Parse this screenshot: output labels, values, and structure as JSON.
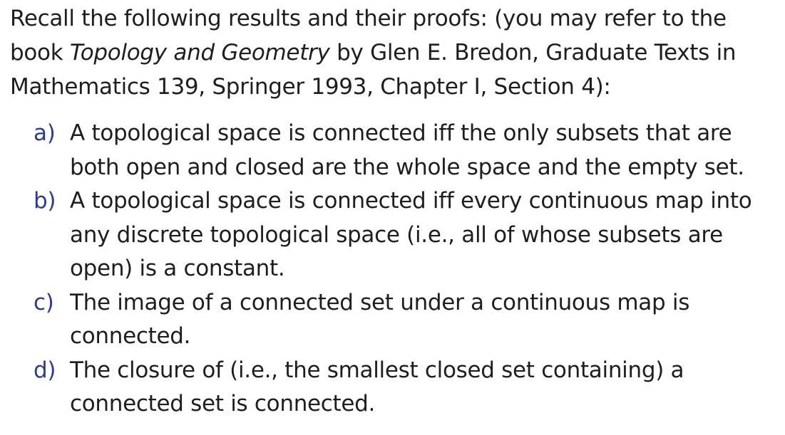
{
  "intro": {
    "before_book": "Recall the following results and their proofs: (you may refer to the book ",
    "book_title": "Topology and Geometry",
    "after_book": " by Glen E. Bredon, Graduate Texts in Mathematics 139, Springer 1993, Chapter I, Section 4):"
  },
  "items": [
    {
      "marker": "a)",
      "text": "A topological space is connected iff the only subsets that are both open and closed are the whole space and the empty set."
    },
    {
      "marker": "b)",
      "text": "A topological space is connected iff every continuous map into any discrete topological space (i.e., all of whose subsets are open) is a constant."
    },
    {
      "marker": "c)",
      "text": "The image of a connected set under a continuous map is connected."
    },
    {
      "marker": "d)",
      "text": "The closure of (i.e., the smallest closed set containing) a connected set is connected."
    }
  ]
}
